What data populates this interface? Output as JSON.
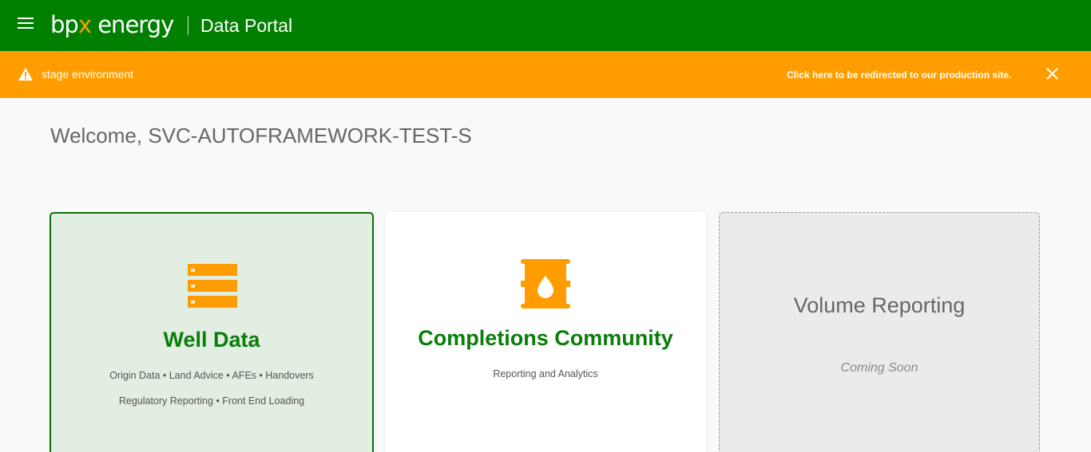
{
  "header": {
    "logo_prefix": "bp",
    "logo_x": "x",
    "logo_suffix": " energy",
    "title": "Data Portal",
    "menu_icon": "hamburger-menu-icon"
  },
  "banner": {
    "warning_icon": "warning-triangle-icon",
    "environment_text": "stage environment",
    "redirect_text": "Click here to be redirected to our production site.",
    "close_icon": "close-icon"
  },
  "welcome": {
    "text": "Welcome, SVC-AUTOFRAMEWORK-TEST-S"
  },
  "cards": {
    "well_data": {
      "icon": "storage-stack-icon",
      "title": "Well Data",
      "subtitle_line1": "Origin Data • Land Advice • AFEs • Handovers",
      "subtitle_line2": "Regulatory Reporting • Front End Loading"
    },
    "completions": {
      "icon": "oil-barrel-icon",
      "title": "Completions Community",
      "subtitle": "Reporting and Analytics"
    },
    "volume": {
      "title": "Volume Reporting",
      "status": "Coming Soon"
    }
  },
  "colors": {
    "header_green": "#007f00",
    "banner_orange": "#ff9d00",
    "accent_orange": "#ff9d00",
    "title_green": "#0a7d0a"
  }
}
